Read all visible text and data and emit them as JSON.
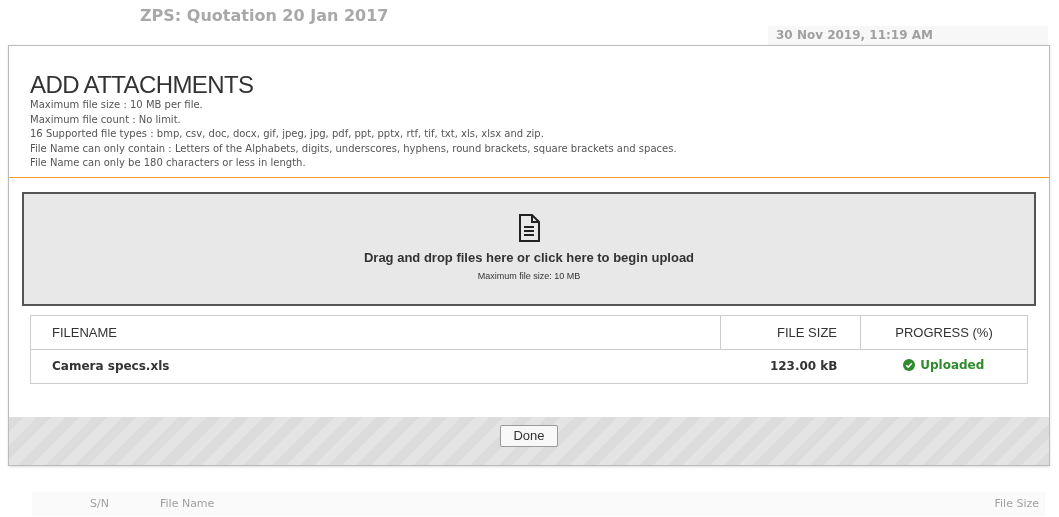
{
  "background": {
    "title": "ZPS: Quotation 20 Jan 2017",
    "date": "30 Nov 2019, 11:19 AM",
    "columns": [
      "S/N",
      "File Name",
      "File Size"
    ]
  },
  "dialog": {
    "title": "ADD ATTACHMENTS",
    "rules": [
      "Maximum file size : 10 MB per file.",
      "Maximum file count : No limit.",
      "16 Supported file types : bmp, csv, doc, docx, gif, jpeg, jpg, pdf, ppt, pptx, rtf, tif, txt, xls, xlsx and zip.",
      "File Name can only contain : Letters of the Alphabets, digits, underscores, hyphens, round brackets, square brackets and spaces.",
      "File Name can only be 180 characters or less in length."
    ],
    "dropzone": {
      "text": "Drag and drop files here or click here to begin upload",
      "subtext": "Maximum file size: 10 MB"
    },
    "table": {
      "columns": [
        "FILENAME",
        "FILE SIZE",
        "PROGRESS (%)"
      ],
      "rows": [
        {
          "filename": "Camera specs.xls",
          "size": "123.00 kB",
          "status": "Uploaded",
          "uploaded": true
        }
      ]
    },
    "done": "Done"
  }
}
